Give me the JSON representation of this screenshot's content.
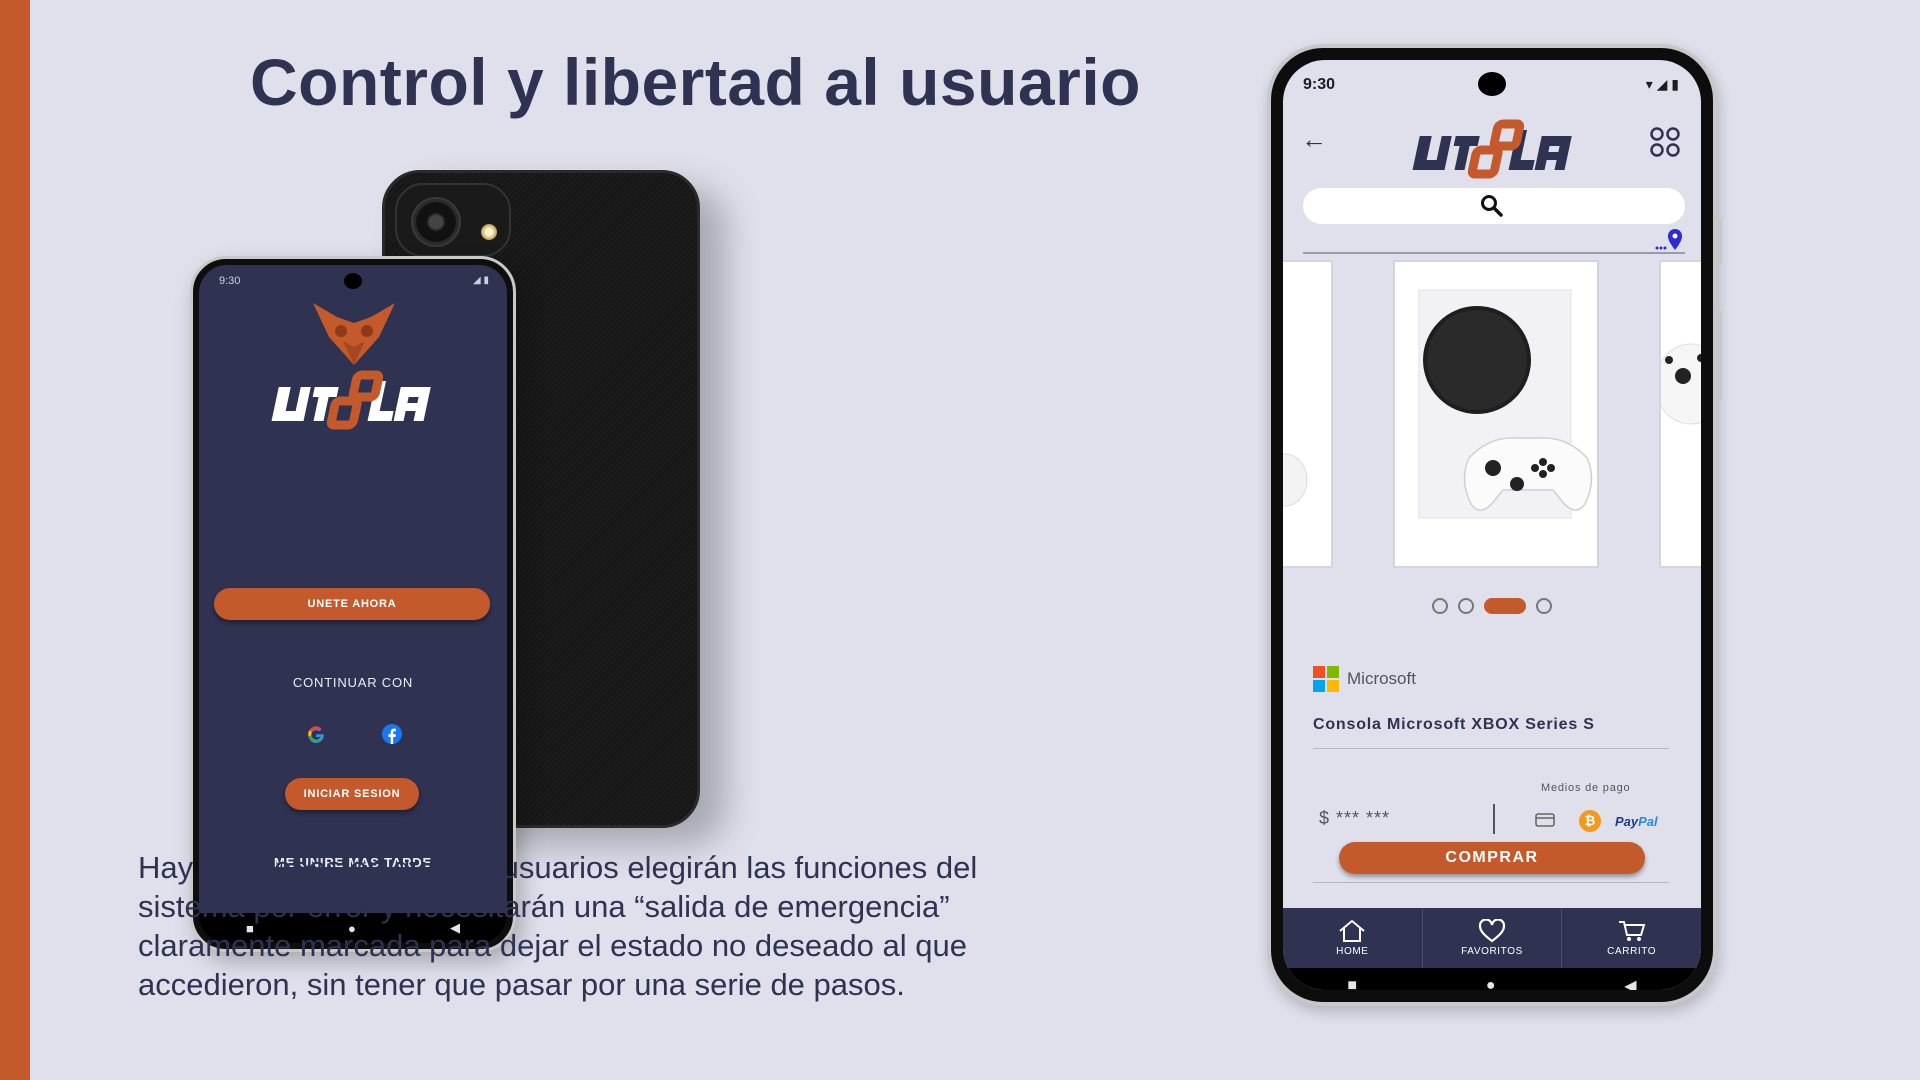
{
  "slide": {
    "title": "Control y libertad al usuario",
    "body": "Hay ocasiones en que los usuarios elegirán las funciones del sistema por error y necesitarán una “salida de emergencia” claramente marcada para dejar el estado no deseado al que accedieron, sin tener que pasar por una serie de pasos.",
    "accent_color": "#c45a2c",
    "background_color": "#dfe0ec"
  },
  "login_screen": {
    "status_time": "9:30",
    "join_button": "UNETE AHORA",
    "continue_label": "CONTINUAR CON",
    "login_button": "INICIAR SESION",
    "later_label": "ME UNIRE MAS TARDE",
    "social_icons": [
      "google-icon",
      "facebook-icon"
    ],
    "system_nav": [
      "■",
      "●",
      "◀"
    ]
  },
  "product_screen": {
    "status_time": "9:30",
    "back_icon": "←",
    "search_icon": "search-icon",
    "carousel": {
      "slides": 4,
      "active_index": 2
    },
    "brand": "Microsoft",
    "product_name": "Consola Microsoft XBOX Series S",
    "payment_label": "Medios de pago",
    "currency_symbol": "$",
    "price": "*** ***",
    "bitcoin_symbol": "₿",
    "paypal_a": "Pay",
    "paypal_b": "Pal",
    "buy_button": "COMPRAR",
    "nav": {
      "home": "HOME",
      "favorites": "FAVORITOS",
      "cart": "CARRITO"
    },
    "system_nav": [
      "■",
      "●",
      "◀"
    ]
  }
}
